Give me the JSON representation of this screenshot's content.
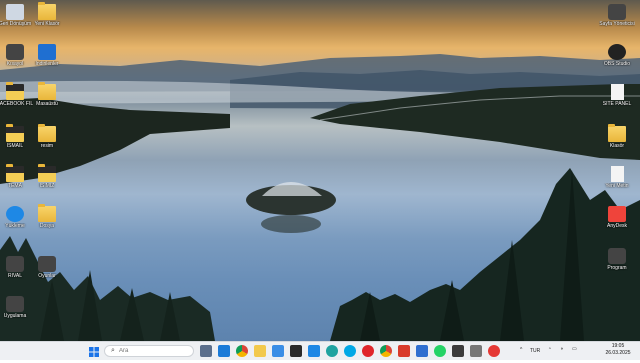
{
  "desktop": {
    "left_icons": [
      {
        "label": "Geri Dönüşüm",
        "icon": "recycle-bin-icon"
      },
      {
        "label": "Yeni Klasör",
        "icon": "folder-icon"
      },
      {
        "label": "Kısayol",
        "icon": "app-icon"
      },
      {
        "label": "İndirilenler",
        "icon": "download-icon"
      },
      {
        "label": "FACEBOOK FILM",
        "icon": "folder-dark-icon"
      },
      {
        "label": "Masaüstü",
        "icon": "folder-icon"
      },
      {
        "label": "ISMAIL",
        "icon": "folder-dark-icon"
      },
      {
        "label": "resim",
        "icon": "folder-icon"
      },
      {
        "label": "TEMA",
        "icon": "folder-dark-icon"
      },
      {
        "label": "ISIMIZ",
        "icon": "folder-dark-icon"
      },
      {
        "label": "Yükleme",
        "icon": "app-blue-icon"
      },
      {
        "label": "Dosya",
        "icon": "folder-icon"
      },
      {
        "label": "RIVAL",
        "icon": "app-icon"
      },
      {
        "label": "Oyunlar",
        "icon": "app-icon"
      },
      {
        "label": "Uygulama",
        "icon": "app-icon"
      }
    ],
    "right_icons": [
      {
        "label": "Sayfa Yöneticisi",
        "icon": "app-icon"
      },
      {
        "label": "OBS Studio",
        "icon": "obs-icon"
      },
      {
        "label": "SİTE PANEL",
        "icon": "document-icon"
      },
      {
        "label": "Klasör",
        "icon": "folder-icon"
      },
      {
        "label": "Yeni Metin",
        "icon": "document-icon"
      },
      {
        "label": "AnyDesk",
        "icon": "anydesk-icon"
      },
      {
        "label": "Program",
        "icon": "app-icon"
      }
    ]
  },
  "taskbar": {
    "search_placeholder": "Ara",
    "clock_time": "19:05",
    "clock_date": "26.03.2025",
    "tray_lang": "TUR"
  }
}
